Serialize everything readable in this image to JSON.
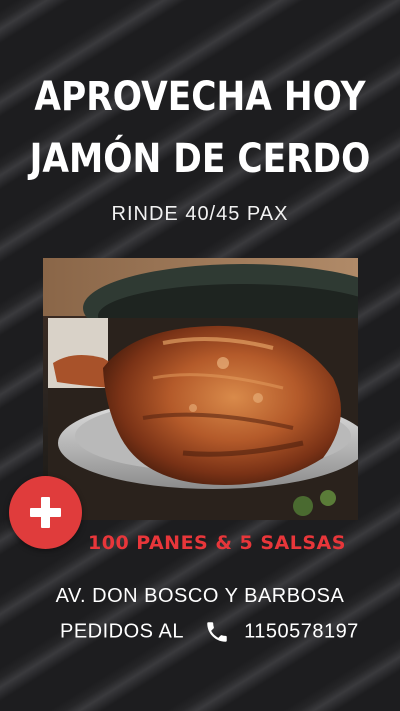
{
  "headline": {
    "line1": "APROVECHA HOY",
    "line2": "JAMÓN DE CERDO"
  },
  "subtitle": "RINDE 40/45 PAX",
  "photo": {
    "subject": "roasted-pork-ham-on-silver-platter"
  },
  "badge": {
    "icon": "plus-icon",
    "color": "#e03c3c"
  },
  "promo": {
    "text": "100 PANES & 5 SALSAS",
    "color": "#e8363a"
  },
  "address": "AV. DON BOSCO Y BARBOSA",
  "orders": {
    "label": "PEDIDOS AL",
    "icon": "phone-icon",
    "phone": "1150578197"
  }
}
